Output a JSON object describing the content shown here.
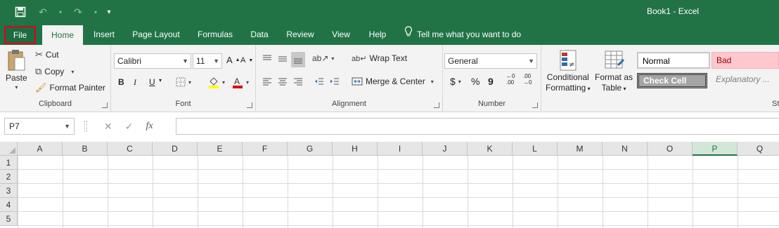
{
  "window": {
    "title": "Book1  -  Excel"
  },
  "qat": {
    "save_icon": "save-icon",
    "undo_icon": "undo-icon",
    "redo_icon": "redo-icon",
    "customize_icon": "customize-qat-icon"
  },
  "tabs": [
    {
      "label": "File"
    },
    {
      "label": "Home"
    },
    {
      "label": "Insert"
    },
    {
      "label": "Page Layout"
    },
    {
      "label": "Formulas"
    },
    {
      "label": "Data"
    },
    {
      "label": "Review"
    },
    {
      "label": "View"
    },
    {
      "label": "Help"
    }
  ],
  "tellme": {
    "label": "Tell me what you want to do"
  },
  "clipboard": {
    "paste": "Paste",
    "cut": "Cut",
    "copy": "Copy",
    "format_painter": "Format Painter",
    "group": "Clipboard"
  },
  "font": {
    "name": "Calibri",
    "size": "11",
    "group": "Font",
    "bold": "B",
    "italic": "I",
    "underline": "U"
  },
  "alignment": {
    "wrap_text": "Wrap Text",
    "merge_center": "Merge & Center",
    "group": "Alignment"
  },
  "number": {
    "format": "General",
    "currency": "$",
    "percent": "%",
    "comma": "9",
    "group": "Number",
    "inc_decimal": "←0 .00",
    "dec_decimal": ".00 →0"
  },
  "styles": {
    "conditional_formatting_l1": "Conditional",
    "conditional_formatting_l2": "Formatting",
    "format_as_table_l1": "Format as",
    "format_as_table_l2": "Table",
    "normal": "Normal",
    "bad": "Bad",
    "check_cell": "Check Cell",
    "explanatory": "Explanatory ...",
    "group_partial": "St"
  },
  "formula_bar": {
    "name_box": "P7",
    "fx": "fx",
    "cancel": "✕",
    "enter": "✓",
    "value": ""
  },
  "grid": {
    "columns": [
      "A",
      "B",
      "C",
      "D",
      "E",
      "F",
      "G",
      "H",
      "I",
      "J",
      "K",
      "L",
      "M",
      "N",
      "O",
      "P",
      "Q"
    ],
    "rows": [
      "1",
      "2",
      "3",
      "4",
      "5"
    ],
    "selected_column": "P"
  },
  "colors": {
    "brand": "#217346",
    "file_outline": "#e0001a",
    "bad_fill": "#ffc7ce",
    "bad_text": "#9c0006",
    "check_fill": "#a5a5a5"
  }
}
